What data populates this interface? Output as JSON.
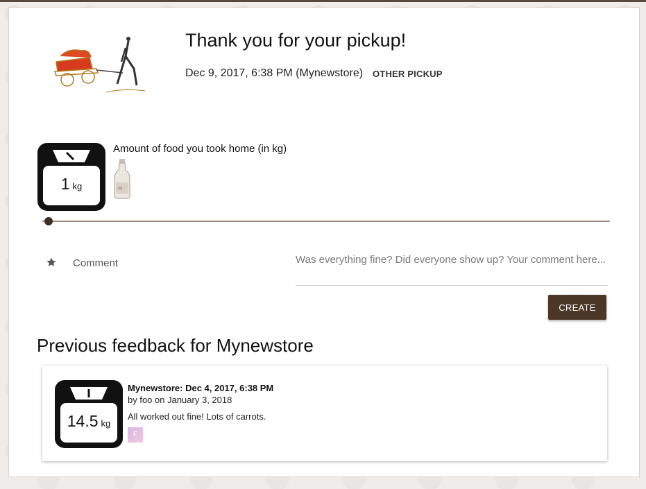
{
  "header": {
    "title": "Thank you for your pickup!",
    "subtitle": "Dec 9, 2017, 6:38 PM (Mynewstore)",
    "other_pickup_label": "OTHER PICKUP"
  },
  "amount": {
    "label": "Amount of food you took home (in kg)",
    "value": "1",
    "unit": "kg",
    "slider_fraction": 0.0
  },
  "comment": {
    "label": "Comment",
    "placeholder": "Was everything fine? Did everyone show up? Your comment here...",
    "value": ""
  },
  "create_label": "CREATE",
  "previous": {
    "heading": "Previous feedback for Mynewstore",
    "items": [
      {
        "value": "14.5",
        "unit": "kg",
        "title": "Mynewstore: Dec 4, 2017, 6:38 PM",
        "by": "by foo on January 3, 2018",
        "text": "All worked out fine! Lots of carrots.",
        "avatar_initial": "F"
      }
    ]
  },
  "colors": {
    "accent": "#4a3726",
    "slider_track": "#a08e7c",
    "slider_thumb": "#3e2f24"
  },
  "icons": [
    "star-icon",
    "scale-icon",
    "bottle-icon",
    "cart-logo"
  ]
}
